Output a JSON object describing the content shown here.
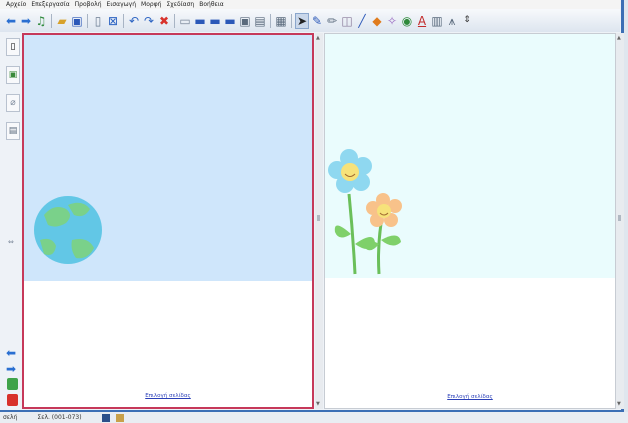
{
  "menu": [
    "Αρχείο",
    "Επεξεργασία",
    "Προβολή",
    "Εισαγωγή",
    "Μορφή",
    "Σχεδίαση",
    "Βοήθεια"
  ],
  "toolbar_icons": [
    "arrow-left-icon",
    "arrow-right-icon",
    "sound-icon",
    "open-folder-icon",
    "save-icon",
    "new-page-icon",
    "export-icon",
    "undo-icon",
    "redo-icon",
    "delete-icon",
    "screen-shade-icon",
    "display-icon",
    "monitor-icon",
    "monitor-2-icon",
    "capture-icon",
    "text-icon",
    "table-icon",
    "select-pointer-icon",
    "pen-icon",
    "highlighter-icon",
    "eraser-icon",
    "line-icon",
    "shape-icon",
    "magic-pen-icon",
    "fill-icon",
    "text-A-icon",
    "dictionary-icon",
    "compass-icon",
    "more-icon"
  ],
  "pages": {
    "left_edit_link": "Επιλογή σελίδας",
    "right_edit_link": "Επιλογή σελίδας"
  },
  "taskbar": {
    "left_text": "σελή",
    "page_text": "Σελ. (001-073)"
  },
  "colors": {
    "left_sky": "#cfe6fb",
    "right_sky": "#eafcfd",
    "selection_border": "#c6395a",
    "window_border": "#3c6fb5"
  }
}
